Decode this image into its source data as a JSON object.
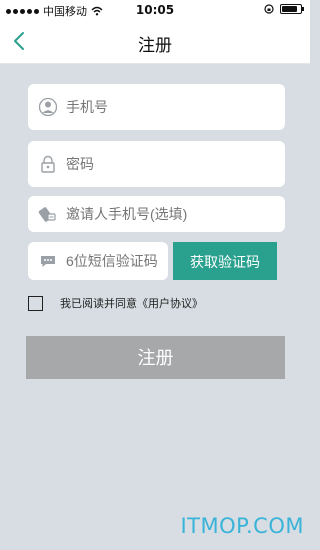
{
  "status_bar": {
    "carrier": "中国移动",
    "time": "10:05",
    "battery_level": 0.85
  },
  "nav": {
    "title": "注册"
  },
  "form": {
    "phone": {
      "placeholder": "手机号",
      "icon": "user-icon"
    },
    "password": {
      "placeholder": "密码",
      "icon": "lock-icon"
    },
    "invite": {
      "placeholder": "邀请人手机号(选填)",
      "icon": "phone-tag-icon"
    },
    "sms_code": {
      "placeholder": "6位短信验证码",
      "icon": "chat-bubble-icon"
    },
    "get_code_label": "获取验证码",
    "agreement_text": "我已阅读并同意《用户协议》",
    "agreement_checked": false,
    "register_label": "注册"
  },
  "colors": {
    "accent": "#2aa08e",
    "register_disabled": "#a6a8a9",
    "background": "#d7dde2"
  },
  "watermark": "ITMOP.COM"
}
